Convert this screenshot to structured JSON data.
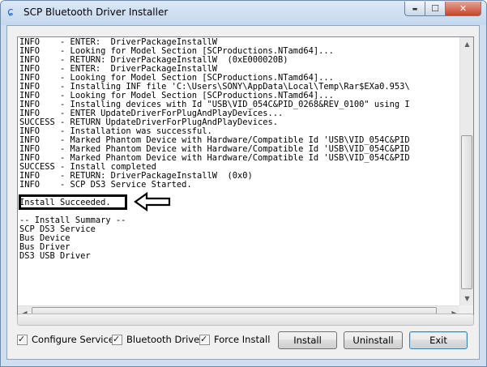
{
  "window": {
    "title": "SCP Bluetooth Driver Installer",
    "close_glyph": "✕",
    "minimize_glyph": "▬",
    "maximize_glyph": "☐",
    "app_icon_glyph": "ɕ"
  },
  "log": {
    "lines": [
      "INFO    - ENTER:  DriverPackageInstallW",
      "INFO    - Looking for Model Section [SCProductions.NTamd64]...",
      "INFO    - RETURN: DriverPackageInstallW  (0xE000020B)",
      "INFO    - ENTER:  DriverPackageInstallW",
      "INFO    - Looking for Model Section [SCProductions.NTamd64]...",
      "INFO    - Installing INF file 'C:\\Users\\SONY\\AppData\\Local\\Temp\\Rar$EXa0.953\\",
      "INFO    - Looking for Model Section [SCProductions.NTamd64]...",
      "INFO    - Installing devices with Id \"USB\\VID_054C&PID_0268&REV_0100\" using I",
      "INFO    - ENTER UpdateDriverForPlugAndPlayDevices...",
      "SUCCESS - RETURN UpdateDriverForPlugAndPlayDevices.",
      "INFO    - Installation was successful.",
      "INFO    - Marked Phantom Device with Hardware/Compatible Id 'USB\\VID_054C&PID",
      "INFO    - Marked Phantom Device with Hardware/Compatible Id 'USB\\VID_054C&PID",
      "INFO    - Marked Phantom Device with Hardware/Compatible Id 'USB\\VID_054C&PID",
      "SUCCESS - Install completed",
      "INFO    - RETURN: DriverPackageInstallW  (0x0)",
      "INFO    - SCP DS3 Service Started.",
      "",
      "Install Succeeded.",
      "",
      "-- Install Summary --",
      "SCP DS3 Service",
      "Bus Device",
      "Bus Driver",
      "DS3 USB Driver"
    ]
  },
  "progress": {
    "value": 0
  },
  "options": {
    "configure_service": {
      "label": "Configure Service",
      "checked": true
    },
    "bluetooth_driver": {
      "label": "Bluetooth Driver",
      "checked": true
    },
    "force_install": {
      "label": "Force Install",
      "checked": true
    }
  },
  "buttons": {
    "install": "Install",
    "uninstall": "Uninstall",
    "exit": "Exit"
  },
  "glyphs": {
    "check": "✓",
    "scroll_up": "▲",
    "scroll_down": "▼",
    "scroll_left": "◀",
    "scroll_right": "▶"
  }
}
